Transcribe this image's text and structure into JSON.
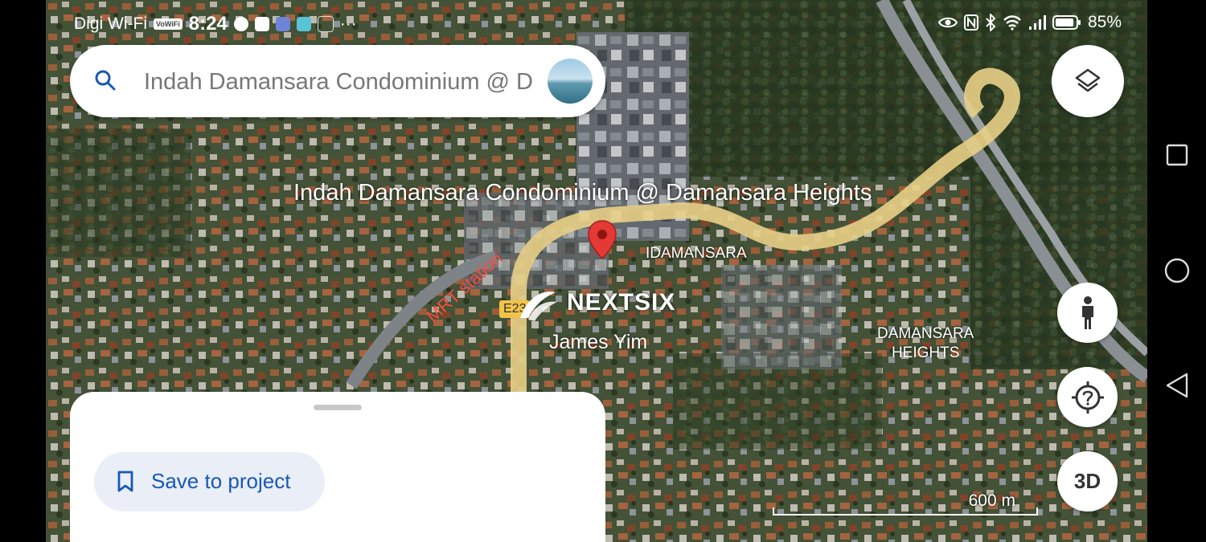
{
  "status_bar": {
    "carrier": "Digi Wi-Fi",
    "volte": "VoWiFi",
    "time": "8:24",
    "more": "···",
    "battery": "85%"
  },
  "search": {
    "value": "Indah Damansara Condominium @ D",
    "icon": "search-icon"
  },
  "map": {
    "place_title": "Indah Damansara Condominium @ Damansara Heights",
    "label_idamansara": "IDAMANSARA",
    "label_mrt": "MRT station",
    "label_road": "E23",
    "label_brand": "NEXTSIX",
    "label_person": "James Yim",
    "label_heights_line1": "DAMANSARA",
    "label_heights_line2": "HEIGHTS",
    "scale": "600 m",
    "pin_color": "#e53935",
    "road_color": "#e8cf86"
  },
  "controls": {
    "layers_icon": "layers-icon",
    "pegman_icon": "pegman-icon",
    "location_icon": "location-unknown-icon",
    "three_d_label": "3D"
  },
  "sheet": {
    "save_label": "Save to project",
    "save_icon": "bookmark-icon"
  },
  "colors": {
    "accent": "#1a57b5",
    "save_bg": "#e9eef7"
  }
}
